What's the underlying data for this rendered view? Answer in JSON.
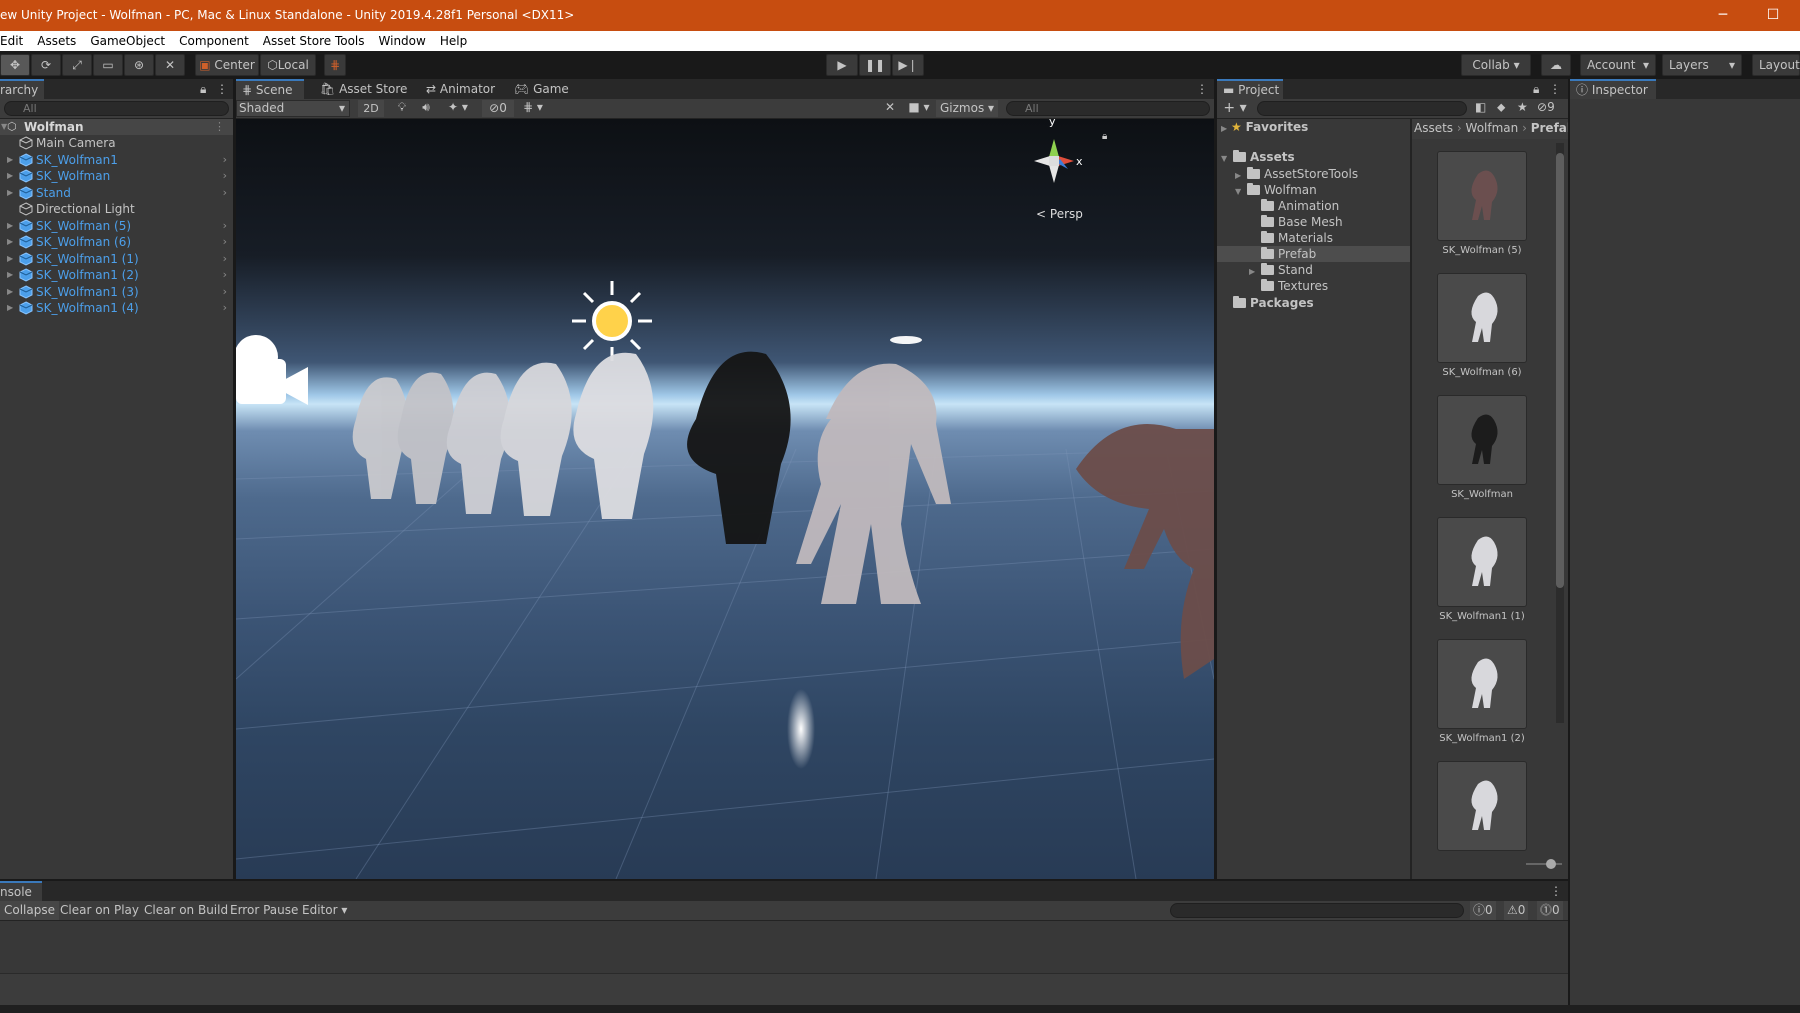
{
  "window": {
    "title": "ew Unity Project - Wolfman - PC, Mac & Linux Standalone - Unity 2019.4.28f1 Personal <DX11>",
    "minimize": "─",
    "maximize": "☐"
  },
  "menu": [
    "Edit",
    "Assets",
    "GameObject",
    "Component",
    "Asset Store Tools",
    "Window",
    "Help"
  ],
  "toolbar": {
    "pivot_center": "Center",
    "pivot_local": "Local",
    "collab": "Collab",
    "account": "Account",
    "layers": "Layers",
    "layout": "Layout"
  },
  "hierarchy": {
    "tab": "rarchy",
    "search_placeholder": "All",
    "scene": "Wolfman",
    "items": [
      {
        "label": "Main Camera",
        "prefab": false,
        "expandable": false
      },
      {
        "label": "SK_Wolfman1",
        "prefab": true,
        "expandable": true
      },
      {
        "label": "SK_Wolfman",
        "prefab": true,
        "expandable": true
      },
      {
        "label": "Stand",
        "prefab": true,
        "expandable": true
      },
      {
        "label": "Directional Light",
        "prefab": false,
        "expandable": false
      },
      {
        "label": "SK_Wolfman (5)",
        "prefab": true,
        "expandable": true
      },
      {
        "label": "SK_Wolfman (6)",
        "prefab": true,
        "expandable": true
      },
      {
        "label": "SK_Wolfman1 (1)",
        "prefab": true,
        "expandable": true
      },
      {
        "label": "SK_Wolfman1 (2)",
        "prefab": true,
        "expandable": true
      },
      {
        "label": "SK_Wolfman1 (3)",
        "prefab": true,
        "expandable": true
      },
      {
        "label": "SK_Wolfman1 (4)",
        "prefab": true,
        "expandable": true
      }
    ]
  },
  "scene_view": {
    "tabs": [
      "Scene",
      "Asset Store",
      "Animator",
      "Game"
    ],
    "shading": "Shaded",
    "mode_2d": "2D",
    "hidden_count": "0",
    "gizmos": "Gizmos",
    "search_placeholder": "All",
    "persp": "Persp",
    "axis_y": "y",
    "axis_x": "x"
  },
  "project": {
    "tab": "Project",
    "hidden_count": "9",
    "favorites": "Favorites",
    "tree": [
      {
        "label": "Assets",
        "bold": true
      },
      {
        "label": "AssetStoreTools"
      },
      {
        "label": "Wolfman"
      },
      {
        "label": "Animation"
      },
      {
        "label": "Base Mesh"
      },
      {
        "label": "Materials"
      },
      {
        "label": "Prefab"
      },
      {
        "label": "Stand"
      },
      {
        "label": "Textures"
      },
      {
        "label": "Packages",
        "bold": true
      }
    ],
    "breadcrumb": [
      "Assets",
      "Wolfman",
      "Prefal"
    ],
    "assets": [
      "SK_Wolfman (5)",
      "SK_Wolfman (6)",
      "SK_Wolfman",
      "SK_Wolfman1 (1)",
      "SK_Wolfman1 (2)"
    ]
  },
  "inspector": {
    "tab": "Inspector"
  },
  "console": {
    "tab": "nsole",
    "buttons": [
      "Collapse",
      "Clear on Play",
      "Clear on Build",
      "Error Pause",
      "Editor"
    ],
    "log_count": "0",
    "warning_count": "0",
    "error_count": "0"
  }
}
